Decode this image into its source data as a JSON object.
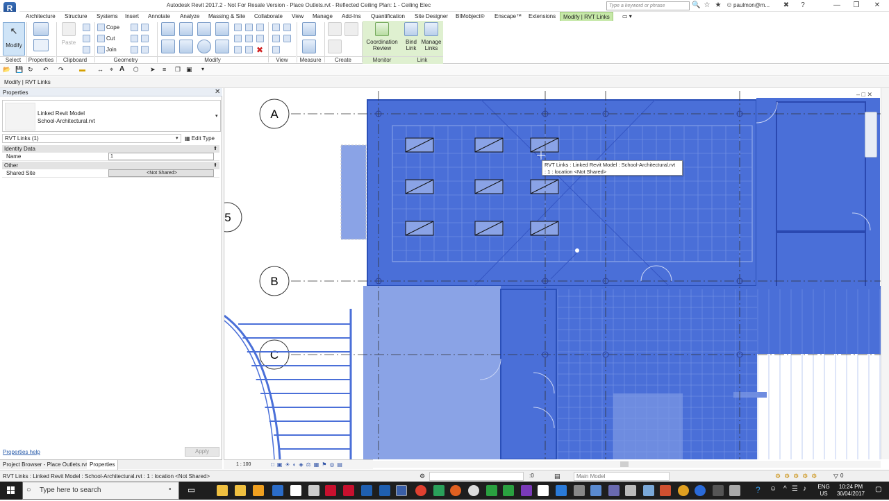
{
  "window": {
    "title": "Autodesk Revit 2017.2 -  Not For Resale Version -    Place Outlets.rvt - Reflected Ceiling Plan: 1 - Ceiling Elec",
    "search_placeholder": "Type a keyword or phrase",
    "user": "paulmon@m...",
    "logo_letter": "R"
  },
  "ribbon": {
    "tabs": [
      "Architecture",
      "Structure",
      "Systems",
      "Insert",
      "Annotate",
      "Analyze",
      "Massing & Site",
      "Collaborate",
      "View",
      "Manage",
      "Add-Ins",
      "Quantification",
      "Site Designer",
      "BIMobject®",
      "Enscape™",
      "Extensions",
      "Modify | RVT Links"
    ],
    "active_tab": "Modify | RVT Links",
    "buttons": {
      "modify": "Modify",
      "paste": "Paste",
      "cope": "Cope",
      "cut": "Cut",
      "join": "Join",
      "coordination_review_1": "Coordination",
      "coordination_review_2": "Review",
      "bind_link_1": "Bind",
      "bind_link_2": "Link",
      "manage_links_1": "Manage",
      "manage_links_2": "Links"
    },
    "panels": {
      "select": "Select",
      "properties": "Properties",
      "clipboard": "Clipboard",
      "geometry": "Geometry",
      "modify": "Modify",
      "view": "View",
      "measure": "Measure",
      "create": "Create",
      "monitor": "Monitor",
      "link": "Link"
    }
  },
  "options_bar": {
    "label": "Modify | RVT Links"
  },
  "properties": {
    "title": "Properties",
    "type_line1": "Linked Revit Model",
    "type_line2": "School-Architectural.rvt",
    "instance_filter": "RVT Links (1)",
    "edit_type": "Edit Type",
    "sections": {
      "identity": "Identity Data",
      "other": "Other"
    },
    "rows": {
      "name_key": "Name",
      "name_value": "1",
      "shared_site_key": "Shared Site",
      "shared_site_value": "<Not Shared>"
    },
    "help": "Properties help",
    "apply": "Apply"
  },
  "palette_tabs": [
    "Project Browser - Place Outlets.rvt",
    "Properties"
  ],
  "view": {
    "scale": "1 : 100",
    "grid_labels": [
      "A",
      "B",
      "C",
      "5"
    ],
    "tooltip_line1": "RVT Links : Linked Revit Model : School-Architectural.rvt",
    "tooltip_line2": ": 1 : location <Not Shared>"
  },
  "status": {
    "text": "RVT Links : Linked Revit Model : School-Architectural.rvt : 1 : location <Not Shared>",
    "selection_count": ":0",
    "main_model": "Main Model",
    "filter_count": "0"
  },
  "taskbar": {
    "search_placeholder": "Type here to search",
    "lang1": "ENG",
    "lang2": "US",
    "time": "10:24 PM",
    "date": "30/04/2017"
  },
  "colors": {
    "link_blue": "#4a6fd8",
    "link_blue_light": "#8aa3e6",
    "active_tab_green": "#c6e8a8",
    "taskbar": "#1e1e1e"
  }
}
